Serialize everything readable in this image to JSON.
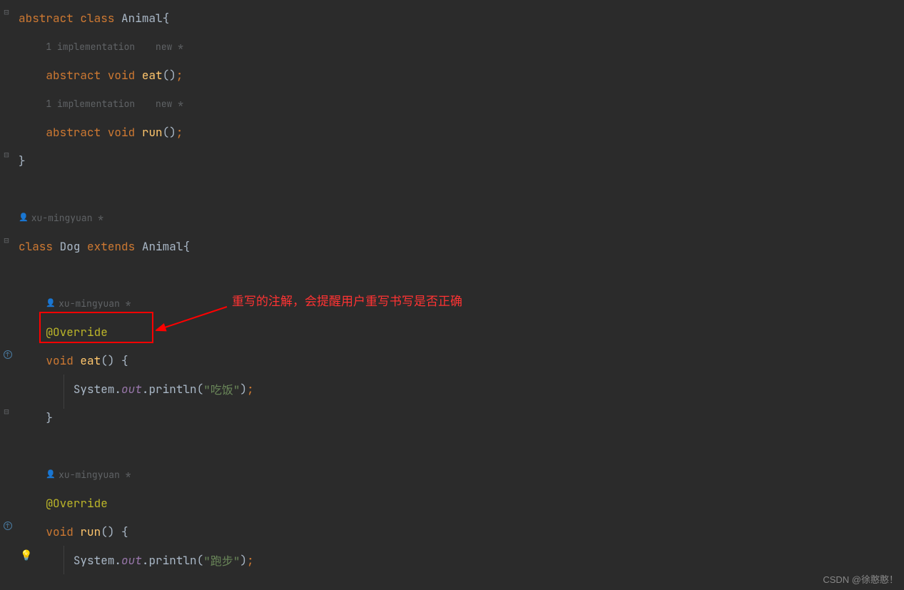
{
  "code": {
    "l1": {
      "kw1": "abstract",
      "kw2": "class",
      "cls": "Animal",
      "brace": "{"
    },
    "l2": {
      "hint1": "1 implementation",
      "hint2": "new *"
    },
    "l3": {
      "kw1": "abstract",
      "kw2": "void",
      "method": "eat",
      "parens": "()",
      "semi": ";"
    },
    "l4": {
      "hint1": "1 implementation",
      "hint2": "new *"
    },
    "l5": {
      "kw1": "abstract",
      "kw2": "void",
      "method": "run",
      "parens": "()",
      "semi": ";"
    },
    "l6": {
      "brace": "}"
    },
    "l8": {
      "author": "xu-mingyuan *"
    },
    "l9": {
      "kw1": "class",
      "cls": "Dog",
      "kw2": "extends",
      "parent": "Animal",
      "brace": "{"
    },
    "l11": {
      "author": "xu-mingyuan *"
    },
    "l12": {
      "ann": "@Override"
    },
    "l13": {
      "kw": "void",
      "method": "eat",
      "parens": "()",
      "brace": " {"
    },
    "l14": {
      "sys": "System.",
      "out": "out",
      "dot": ".",
      "println": "println(",
      "str": "\"吃饭\"",
      "close": ")",
      "semi": ";"
    },
    "l15": {
      "brace": "}"
    },
    "l17": {
      "author": "xu-mingyuan *"
    },
    "l18": {
      "ann": "@Override"
    },
    "l19": {
      "kw": "void",
      "method": "run",
      "parens": "()",
      "brace": " {"
    },
    "l20": {
      "sys": "System.",
      "out": "out",
      "dot": ".",
      "println": "println(",
      "str": "\"跑步\"",
      "close": ")",
      "semi": ";"
    },
    "l21": {
      "brace": "}"
    }
  },
  "annotation": {
    "text": "重写的注解，会提醒用户重写书写是否正确"
  },
  "watermark": "CSDN @徐憨憨！"
}
